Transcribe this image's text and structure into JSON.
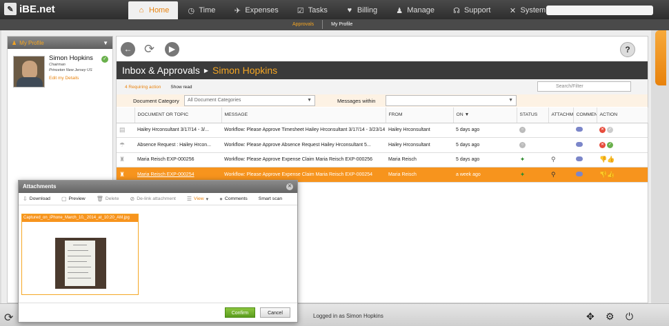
{
  "app": {
    "logo_text": "iBE.net"
  },
  "nav": [
    {
      "icon": "⌂",
      "label": "Home",
      "active": true
    },
    {
      "icon": "◷",
      "label": "Time"
    },
    {
      "icon": "✈",
      "label": "Expenses"
    },
    {
      "icon": "☑",
      "label": "Tasks"
    },
    {
      "icon": "♥",
      "label": "Billing"
    },
    {
      "icon": "♟",
      "label": "Manage"
    },
    {
      "icon": "☊",
      "label": "Support"
    },
    {
      "icon": "✕",
      "label": "System"
    }
  ],
  "subnav": [
    {
      "label": "Approvals",
      "active": true
    },
    {
      "label": "My Profile"
    }
  ],
  "profile": {
    "header": "My Profile",
    "name": "Simon Hopkins",
    "role": "Chairman",
    "location": "Princeton New Jersey US",
    "edit_link": "Edit my Details"
  },
  "main": {
    "title": "Inbox & Approvals",
    "title_person": "Simon Hopkins",
    "requiring_action": "4 Requiring action",
    "show_read": "Show read",
    "search_placeholder": "Search/Filter",
    "doc_category_label": "Document Category",
    "doc_category_value": "All Document Categories",
    "messages_within_label": "Messages within",
    "messages_within_value": ""
  },
  "table": {
    "columns": [
      "DOCUMENT OR TOPIC",
      "MESSAGE",
      "FROM",
      "ON",
      "STATUS",
      "ATTACHM",
      "COMMENT",
      "ACTION"
    ],
    "rows": [
      {
        "doc": "Hailey Hrconsultant 3/17/14 - 3/...",
        "message": "Workflow: Please Approve Timesheet Hailey Hrconsultant 3/17/14 - 3/23/14",
        "from": "Hailey Hrconsultant",
        "on": "5 days ago"
      },
      {
        "doc": "Absence Request : Hailey Hrcon...",
        "message": "Workflow: Please Approve Absence Request Hailey Hrconsultant 5...",
        "from": "Hailey Hrconsultant",
        "on": "5 days ago"
      },
      {
        "doc": "Maria Reisch EXP-000256",
        "message": "Workflow: Please Approve Expense Claim Maria Reisch EXP-000256",
        "from": "Maria Reisch",
        "on": "5 days ago"
      },
      {
        "doc": "Maria Reisch EXP-000254",
        "message": "Workflow: Please Approve Expense Claim Maria Reisch EXP-000254",
        "from": "Maria Reisch",
        "on": "a week ago"
      }
    ]
  },
  "sidetab_label": "",
  "footer": {
    "logged_in": "Logged in as Simon Hopkins"
  },
  "dialog": {
    "title": "Attachments",
    "tools": {
      "download": "Download",
      "preview": "Preview",
      "delete": "Delete",
      "delink": "De-link attachment",
      "view": "View",
      "comments": "Comments",
      "smart_scan": "Smart scan"
    },
    "file_caption": "Captured_on_iPhone_March_10,_2014_at_10:20_AM.jpg",
    "confirm": "Confirm",
    "cancel": "Cancel"
  },
  "colors": {
    "accent": "#f7941d",
    "dark": "#3b3b3b"
  }
}
